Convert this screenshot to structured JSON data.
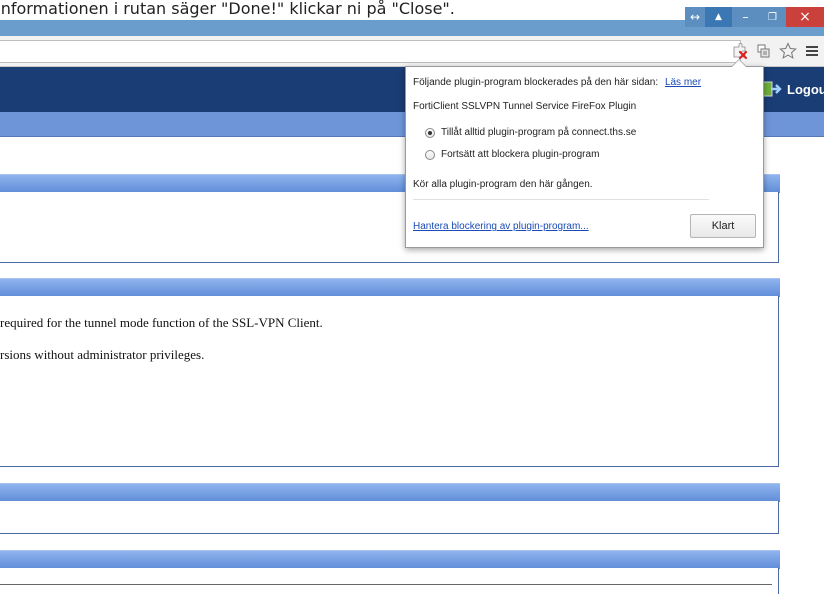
{
  "caption": {
    "text": "Informationen i rutan säger \"Done!\" klickar ni på \"Close\"."
  },
  "window_controls": {
    "resize_symbol": "↔",
    "user_symbol": "▲",
    "minimize_symbol": "–",
    "restore_symbol": "❐",
    "close_symbol": "×"
  },
  "icons": {
    "blocked_plugin": "blocked-plugin-icon",
    "page_action": "page-action-icon",
    "bookmark_star": "star-icon",
    "menu": "hamburger-menu-icon",
    "logout": "logout-icon"
  },
  "site": {
    "logout_label": "Logout"
  },
  "plugin_bubble": {
    "header_text": "Följande plugin-program blockerades på den här sidan:",
    "learn_more_link": "Läs mer",
    "plugin_name": "FortiClient SSLVPN Tunnel Service FireFox Plugin",
    "option_always_allow": "Tillåt alltid plugin-program på connect.ths.se",
    "option_keep_blocking": "Fortsätt att blockera plugin-program",
    "selected_option": "always_allow",
    "run_all_text": "Kör alla plugin-program den här gången.",
    "manage_link": "Hantera blockering av plugin-program...",
    "done_button": "Klart"
  },
  "content": {
    "line_1": "required for the tunnel mode function of the SSL-VPN Client.",
    "line_2": "rsions without administrator privileges."
  },
  "colors": {
    "header_navy": "#1b3d75",
    "panel_blue": "#6f95d9",
    "chrome_frame": "#6a9ccc",
    "close_red": "#c9413a",
    "link_blue": "#1a4bb8"
  }
}
